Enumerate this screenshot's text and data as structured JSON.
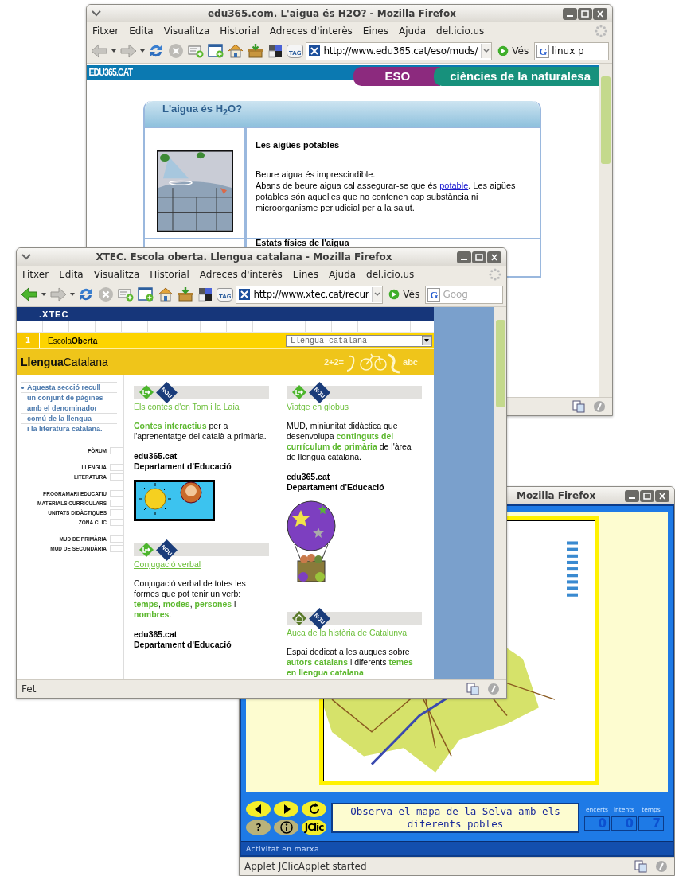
{
  "windows": [
    {
      "kind": "article",
      "title": "edu365.com. L'aigua és H2O? - Mozilla Firefox",
      "menu": [
        "Fitxer",
        "Edita",
        "Visualitza",
        "Historial",
        "Adreces d'interès",
        "Eines",
        "Ajuda",
        "del.icio.us"
      ],
      "back_enabled": false,
      "tag_label": "TAG",
      "url": "http://www.edu365.cat/eso/muds/",
      "go_label": "Vés",
      "search": {
        "engine_label": "G",
        "value": "linux p"
      },
      "page": {
        "logo": "EDU365.CAT",
        "banners": [
          "ESO",
          "ciències de la naturalesa"
        ],
        "card_title": "L'aigua és H$_{2}$O?",
        "sections": [
          {
            "heading": "Les aigües potables",
            "lines": [
              "Beure aigua és imprescindible."
            ],
            "para_before": "Abans de beure aigua cal assegurar-se que és ",
            "link": "potable",
            "para_after": ". Les aigües potables són aquelles que no contenen cap substància ni microorganisme perjudicial per a la salut."
          },
          {
            "heading": "Estats físics de l'aigua"
          }
        ]
      }
    },
    {
      "kind": "portal",
      "title": "XTEC. Escola oberta. Llengua catalana - Mozilla Firefox",
      "menu": [
        "Fitxer",
        "Edita",
        "Visualitza",
        "Historial",
        "Adreces d'interès",
        "Eines",
        "Ajuda",
        "del.icio.us"
      ],
      "back_enabled": true,
      "tag_label": "TAG",
      "url": "http://www.xtec.cat/recur",
      "go_label": "Vés",
      "search": {
        "engine_label": "G",
        "placeholder": "Goog"
      },
      "status": "Fet",
      "page": {
        "logo": ".XTEC",
        "section_number": "1",
        "school_name": "Escola**Oberta**",
        "dropdown": "Llengua catalana",
        "banner_title": "**Llengua**Catalana",
        "banner_art": [
          "2+2=",
          "abc"
        ],
        "intro": [
          "Aquesta secció recull",
          "un conjunt de pàgines",
          "amb el denominador",
          "comú de la llengua",
          "i la literatura catalana."
        ],
        "nav_groups": [
          [
            "FÒRUM"
          ],
          [
            "LLENGUA",
            "LITERATURA"
          ],
          [
            "PROGRAMARI EDUCATIU",
            "MATERIALS CURRICULARS",
            "UNITATS DIDÀCTIQUES",
            "ZONA CLIC"
          ],
          [
            "MUD DE PRIMÀRIA",
            "MUD DE SECUNDÀRIA"
          ]
        ],
        "columns": [
          [
            {
              "badge": "NOU",
              "title": "Els contes d'en Tom i la Laia",
              "description": "**Contes interactius** per a l'aprenentatge del català a primària.",
              "source": [
                "edu365.cat",
                "Departament d'Educació"
              ]
            },
            {
              "badge": "NOU",
              "title": "Conjugació verbal",
              "description": "Conjugació verbal de totes les formes que pot tenir un verb: **temps**, **modes**, **persones** i **nombres**.",
              "source": [
                "edu365.cat",
                "Departament d'Educació"
              ]
            }
          ],
          [
            {
              "badge": "NOU",
              "title": "Viatge en globus",
              "description": "MUD, miniunitat didàctica que desenvolupa **continguts del currículum de primària** de l'àrea de llengua catalana.",
              "source": [
                "edu365.cat",
                "Departament d'Educació"
              ]
            },
            {
              "badge": "NOU",
              "title": "Auca de la història de Catalunya",
              "description": "Espai dedicat a les auques sobre **autors catalans** i diferents **temes en llengua catalana**."
            }
          ]
        ]
      }
    },
    {
      "kind": "applet",
      "title": "Mozilla Firefox",
      "status": "Applet JClicApplet started",
      "applet": {
        "buttons": [
          {
            "kind": "prev",
            "disabled": false
          },
          {
            "kind": "next",
            "disabled": false
          },
          {
            "kind": "restart",
            "disabled": false
          },
          {
            "kind": "help",
            "label": "?",
            "disabled": true
          },
          {
            "kind": "info",
            "disabled": true
          },
          {
            "kind": "about",
            "label": "JClic",
            "disabled": false
          }
        ],
        "message": "Observa el mapa de la Selva amb els diferents pobles",
        "counters": [
          {
            "label": "encerts",
            "value": "0"
          },
          {
            "label": "intents",
            "value": "0"
          },
          {
            "label": "temps",
            "value": "7"
          }
        ],
        "status": "Activitat en marxa"
      }
    }
  ]
}
